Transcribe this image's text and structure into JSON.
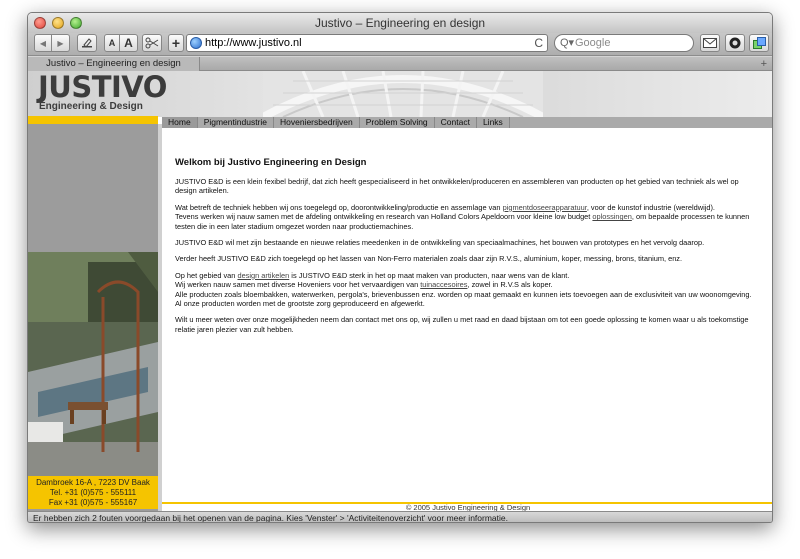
{
  "window": {
    "title": "Justivo – Engineering en design"
  },
  "toolbar": {
    "back_glyph": "◀",
    "forward_glyph": "▶",
    "text_small_label": "A",
    "text_large_label": "A",
    "add_bookmark_glyph": "+",
    "url": "http://www.justivo.nl",
    "reload_glyph": "C",
    "search_placeholder": "Google",
    "search_glyph": "Q▾"
  },
  "tabs": [
    {
      "label": "Justivo – Engineering en design"
    }
  ],
  "tabbar": {
    "new_tab_glyph": "+"
  },
  "site": {
    "logo": {
      "word": "JUSTIVO",
      "subtitle": "Engineering & Design"
    },
    "nav": [
      {
        "label": "Home"
      },
      {
        "label": "Pigmentindustrie"
      },
      {
        "label": "Hoveniersbedrijven"
      },
      {
        "label": "Problem Solving"
      },
      {
        "label": "Contact"
      },
      {
        "label": "Links"
      }
    ],
    "address": {
      "line1": "Dambroek 16-A , 7223 DV Baak",
      "line2": "Tel. +31 (0)575 - 555111",
      "line3": "Fax +31 (0)575 - 555167"
    },
    "content": {
      "heading": "Welkom bij Justivo Engineering en Design",
      "p1": "JUSTIVO E&D is een klein fexibel bedrijf, dat zich heeft gespecialiseerd in het ontwikkelen/produceren en assembleren van producten op het gebied van techniek als wel op design artikelen.",
      "p2_before": "Wat betreft de techniek hebben wij ons toegelegd op, doorontwikkeling/productie en assemlage van ",
      "p2_link": "pigmentdoseerapparatuur",
      "p2_after": ", voor de kunstof industrie (wereldwijd).",
      "p2b_before": "Tevens werken wij nauw samen met de afdeling ontwikkeling en research van Holland Colors Apeldoorn voor kleine low budget ",
      "p2b_link": "oplossingen",
      "p2b_after": ", om bepaalde processen te kunnen testen die in een later stadium omgezet worden naar productiemachines.",
      "p3": "JUSTIVO E&D wil met zijn bestaande en nieuwe relaties meedenken in de ontwikkeling van speciaalmachines, het bouwen van prototypes en het vervolg daarop.",
      "p4": "Verder heeft JUSTIVO E&D zich toegelegd op het lassen van Non-Ferro materialen zoals daar zijn R.V.S., aluminium, koper, messing, brons, titanium, enz.",
      "p5_before": "Op het gebied van ",
      "p5_link": "design artikelen",
      "p5_after": " is JUSTIVO E&D sterk in het op maat maken van producten, naar wens van de klant.",
      "p5b_before": "Wij werken nauw samen met diverse Hoveniers voor het vervaardigen van ",
      "p5b_link": "tuinaccesoires",
      "p5b_after": ", zowel in R.V.S als koper.",
      "p5c": "Alle producten zoals bloembakken, waterwerken, pergola's, brievenbussen enz. worden op maat gemaakt en kunnen iets toevoegen aan de exclusiviteit van uw woonomgeving.",
      "p5d": "Al onze producten worden met de grootste zorg geproduceerd en afgewerkt.",
      "p6": "Wilt u meer weten over onze mogelijkheden neem dan contact met ons op, wij zullen u met raad en daad bijstaan om tot een goede oplossing te komen waar u als toekomstige relatie jaren plezier van zult hebben."
    },
    "footer": "© 2005 Justivo Engineering & Design"
  },
  "statusbar": "Er hebben zich 2 fouten voorgedaan bij het openen van de pagina. Kies 'Venster' > 'Activiteitenoverzicht' voor meer informatie.",
  "colors": {
    "accent_yellow": "#f5c400",
    "sidebar_gray": "#9c9c9c",
    "nav_gray": "#aaaaaa"
  }
}
